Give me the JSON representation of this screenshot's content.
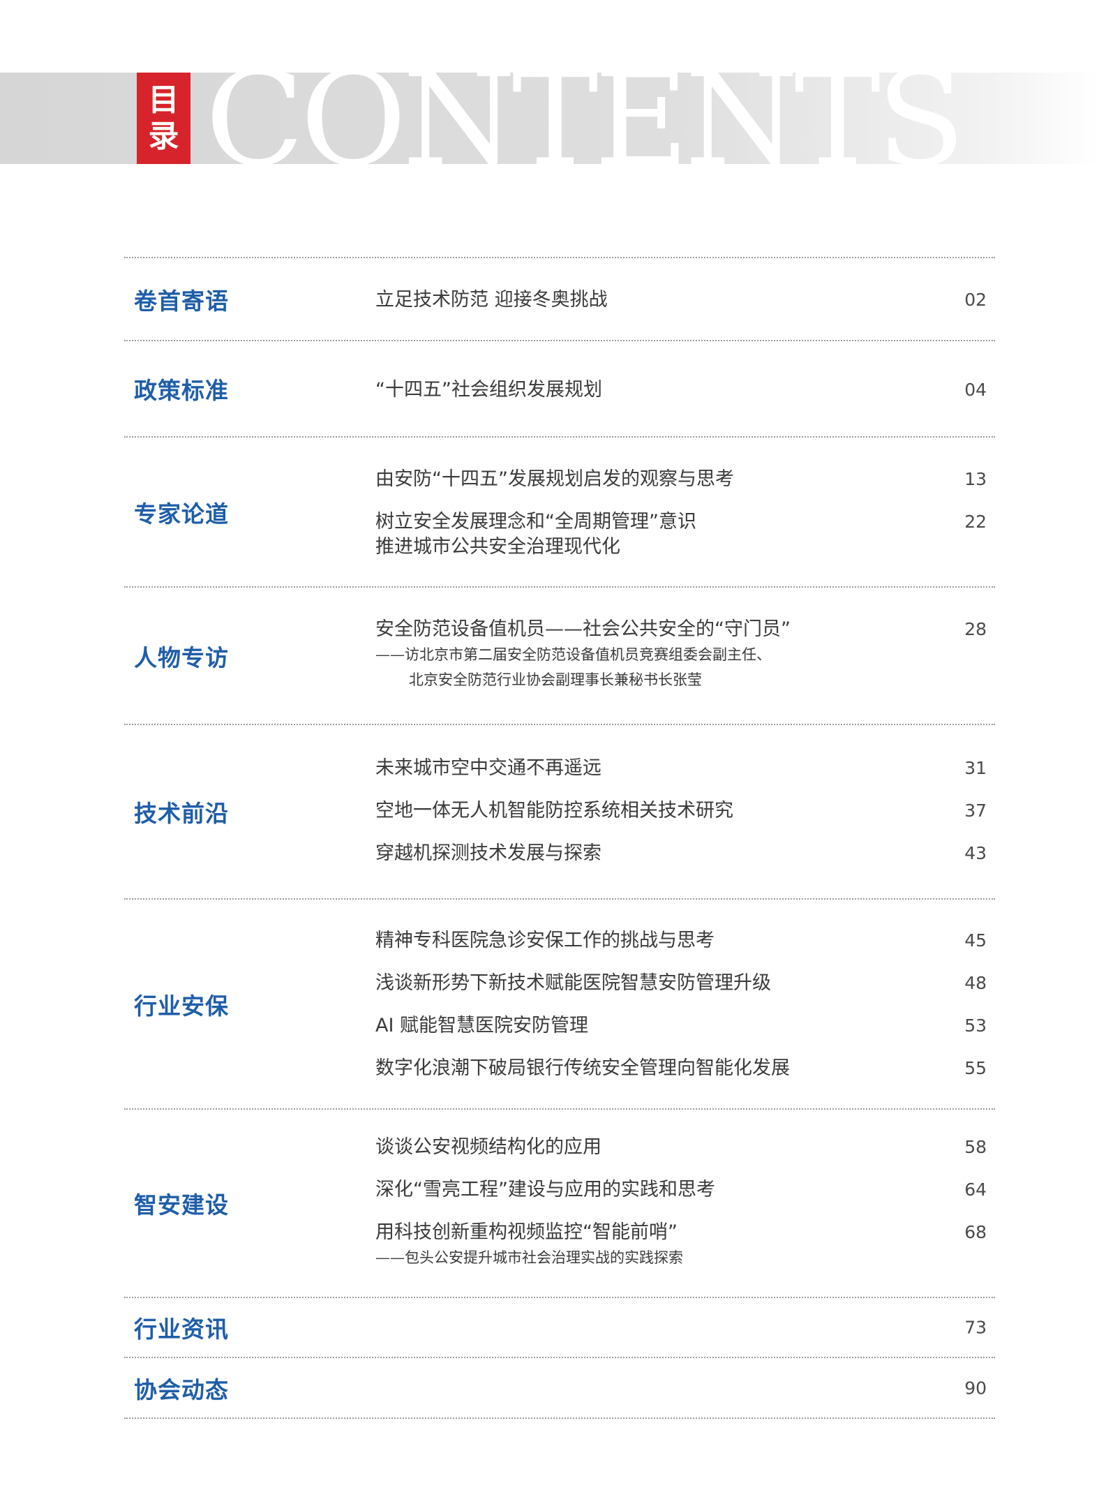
{
  "header": {
    "tag_line1": "目",
    "tag_line2": "录",
    "word": "CONTENTS"
  },
  "sections": [
    {
      "category": "卷首寄语",
      "entries": [
        {
          "title": "立足技术防范  迎接冬奥挑战",
          "page": "02"
        }
      ]
    },
    {
      "category": "政策标准",
      "entries": [
        {
          "title": "“十四五”社会组织发展规划",
          "page": "04"
        }
      ]
    },
    {
      "category": "专家论道",
      "entries": [
        {
          "title": "由安防“十四五”发展规划启发的观察与思考",
          "page": "13"
        },
        {
          "title": "树立安全发展理念和“全周期管理”意识",
          "title2": "推进城市公共安全治理现代化",
          "page": "22"
        }
      ]
    },
    {
      "category": "人物专访",
      "entries": [
        {
          "title": "安全防范设备值机员——社会公共安全的“守门员”",
          "sub1": "——访北京市第二届安全防范设备值机员竞赛组委会副主任、",
          "sub2": "北京安全防范行业协会副理事长兼秘书长张莹",
          "page": "28"
        }
      ]
    },
    {
      "category": "技术前沿",
      "entries": [
        {
          "title": "未来城市空中交通不再遥远",
          "page": "31"
        },
        {
          "title": "空地一体无人机智能防控系统相关技术研究",
          "page": "37"
        },
        {
          "title": "穿越机探测技术发展与探索",
          "page": "43"
        }
      ]
    },
    {
      "category": "行业安保",
      "entries": [
        {
          "title": "精神专科医院急诊安保工作的挑战与思考",
          "page": "45"
        },
        {
          "title": "浅谈新形势下新技术赋能医院智慧安防管理升级",
          "page": "48"
        },
        {
          "title": "AI 赋能智慧医院安防管理",
          "page": "53"
        },
        {
          "title": "数字化浪潮下破局银行传统安全管理向智能化发展",
          "page": "55"
        }
      ]
    },
    {
      "category": "智安建设",
      "entries": [
        {
          "title": "谈谈公安视频结构化的应用",
          "page": "58"
        },
        {
          "title": "深化“雪亮工程”建设与应用的实践和思考",
          "page": "64"
        },
        {
          "title": "用科技创新重构视频监控“智能前哨”",
          "sub1": "——包头公安提升城市社会治理实战的实践探索",
          "page": "68"
        }
      ]
    },
    {
      "category": "行业资讯",
      "page": "73"
    },
    {
      "category": "协会动态",
      "page": "90"
    }
  ]
}
